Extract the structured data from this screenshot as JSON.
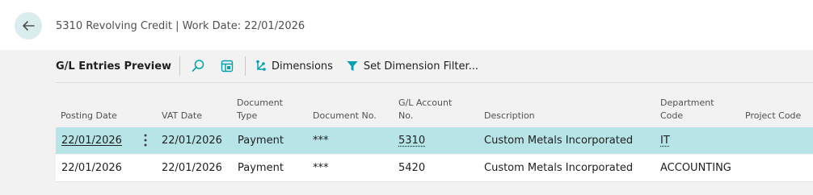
{
  "page": {
    "title": "5310 Revolving Credit | Work Date: 22/01/2026"
  },
  "toolbar": {
    "title": "G/L Entries Preview",
    "dimensions_label": "Dimensions",
    "set_filter_label": "Set Dimension Filter..."
  },
  "columns": {
    "posting_date": "Posting Date",
    "vat_date": "VAT Date",
    "document_type_1": "Document",
    "document_type_2": "Type",
    "document_no": "Document No.",
    "gl_account_no_1": "G/L Account",
    "gl_account_no_2": "No.",
    "description": "Description",
    "department_code_1": "Department",
    "department_code_2": "Code",
    "project_code": "Project Code"
  },
  "rows": [
    {
      "posting_date": "22/01/2026",
      "vat_date": "22/01/2026",
      "document_type": "Payment",
      "document_no": "***",
      "gl_account_no": "5310",
      "description": "Custom Metals Incorporated",
      "department_code": "IT",
      "project_code": ""
    },
    {
      "posting_date": "22/01/2026",
      "vat_date": "22/01/2026",
      "document_type": "Payment",
      "document_no": "***",
      "gl_account_no": "5420",
      "description": "Custom Metals Incorporated",
      "department_code": "ACCOUNTING",
      "project_code": ""
    }
  ],
  "icons": {
    "back": "arrow-left-icon",
    "search": "search-icon",
    "layout": "layout-icon",
    "dimensions": "dimensions-icon",
    "filter": "filter-icon",
    "row_menu": "more-vertical-icon"
  },
  "colors": {
    "accent": "#00a1b0",
    "selected_row": "#b6e4e7",
    "back_button": "#d9ecee"
  }
}
